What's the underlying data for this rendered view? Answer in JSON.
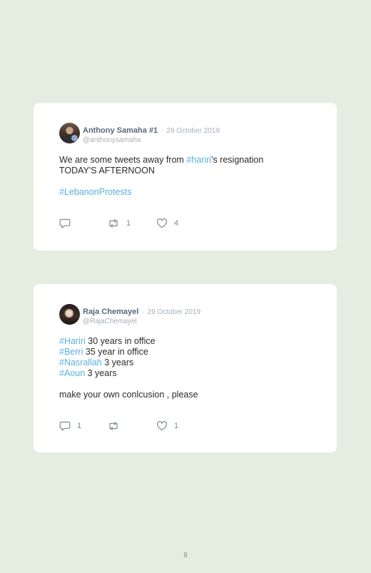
{
  "tweets": [
    {
      "name": "Anthony Samaha #1",
      "separator": "·",
      "date": "29 October 2019",
      "handle": "@anthonysamaha",
      "body": [
        [
          {
            "text": "We are some tweets away from "
          },
          {
            "text": "#hariri",
            "tag": true
          },
          {
            "text": "'s resignation"
          }
        ],
        [
          {
            "text": "TODAY'S AFTERNOON"
          }
        ],
        [],
        [
          {
            "text": "#LebanonProtests",
            "tag": true
          }
        ]
      ],
      "replies": "",
      "retweets": "1",
      "likes": "4"
    },
    {
      "name": "Raja Chemayel",
      "separator": "·",
      "date": "29 October 2019",
      "handle": "@RajaChemayel",
      "body": [
        [
          {
            "text": "#Hariri",
            "tag": true
          },
          {
            "text": " 30 years in office"
          }
        ],
        [
          {
            "text": "#Berri",
            "tag": true
          },
          {
            "text": " 35 year in office"
          }
        ],
        [
          {
            "text": "#Nasrallah",
            "tag": true
          },
          {
            "text": " 3 years"
          }
        ],
        [
          {
            "text": "#Aoun",
            "tag": true
          },
          {
            "text": " 3 years"
          }
        ],
        [],
        [
          {
            "text": "make your own conlcusion , please"
          }
        ]
      ],
      "replies": "1",
      "retweets": "",
      "likes": "1"
    }
  ],
  "page_number": "8",
  "colors": {
    "background": "#e4ede0",
    "hashtag": "#5aaee0",
    "name": "#57677a",
    "muted": "#a6afb8"
  }
}
